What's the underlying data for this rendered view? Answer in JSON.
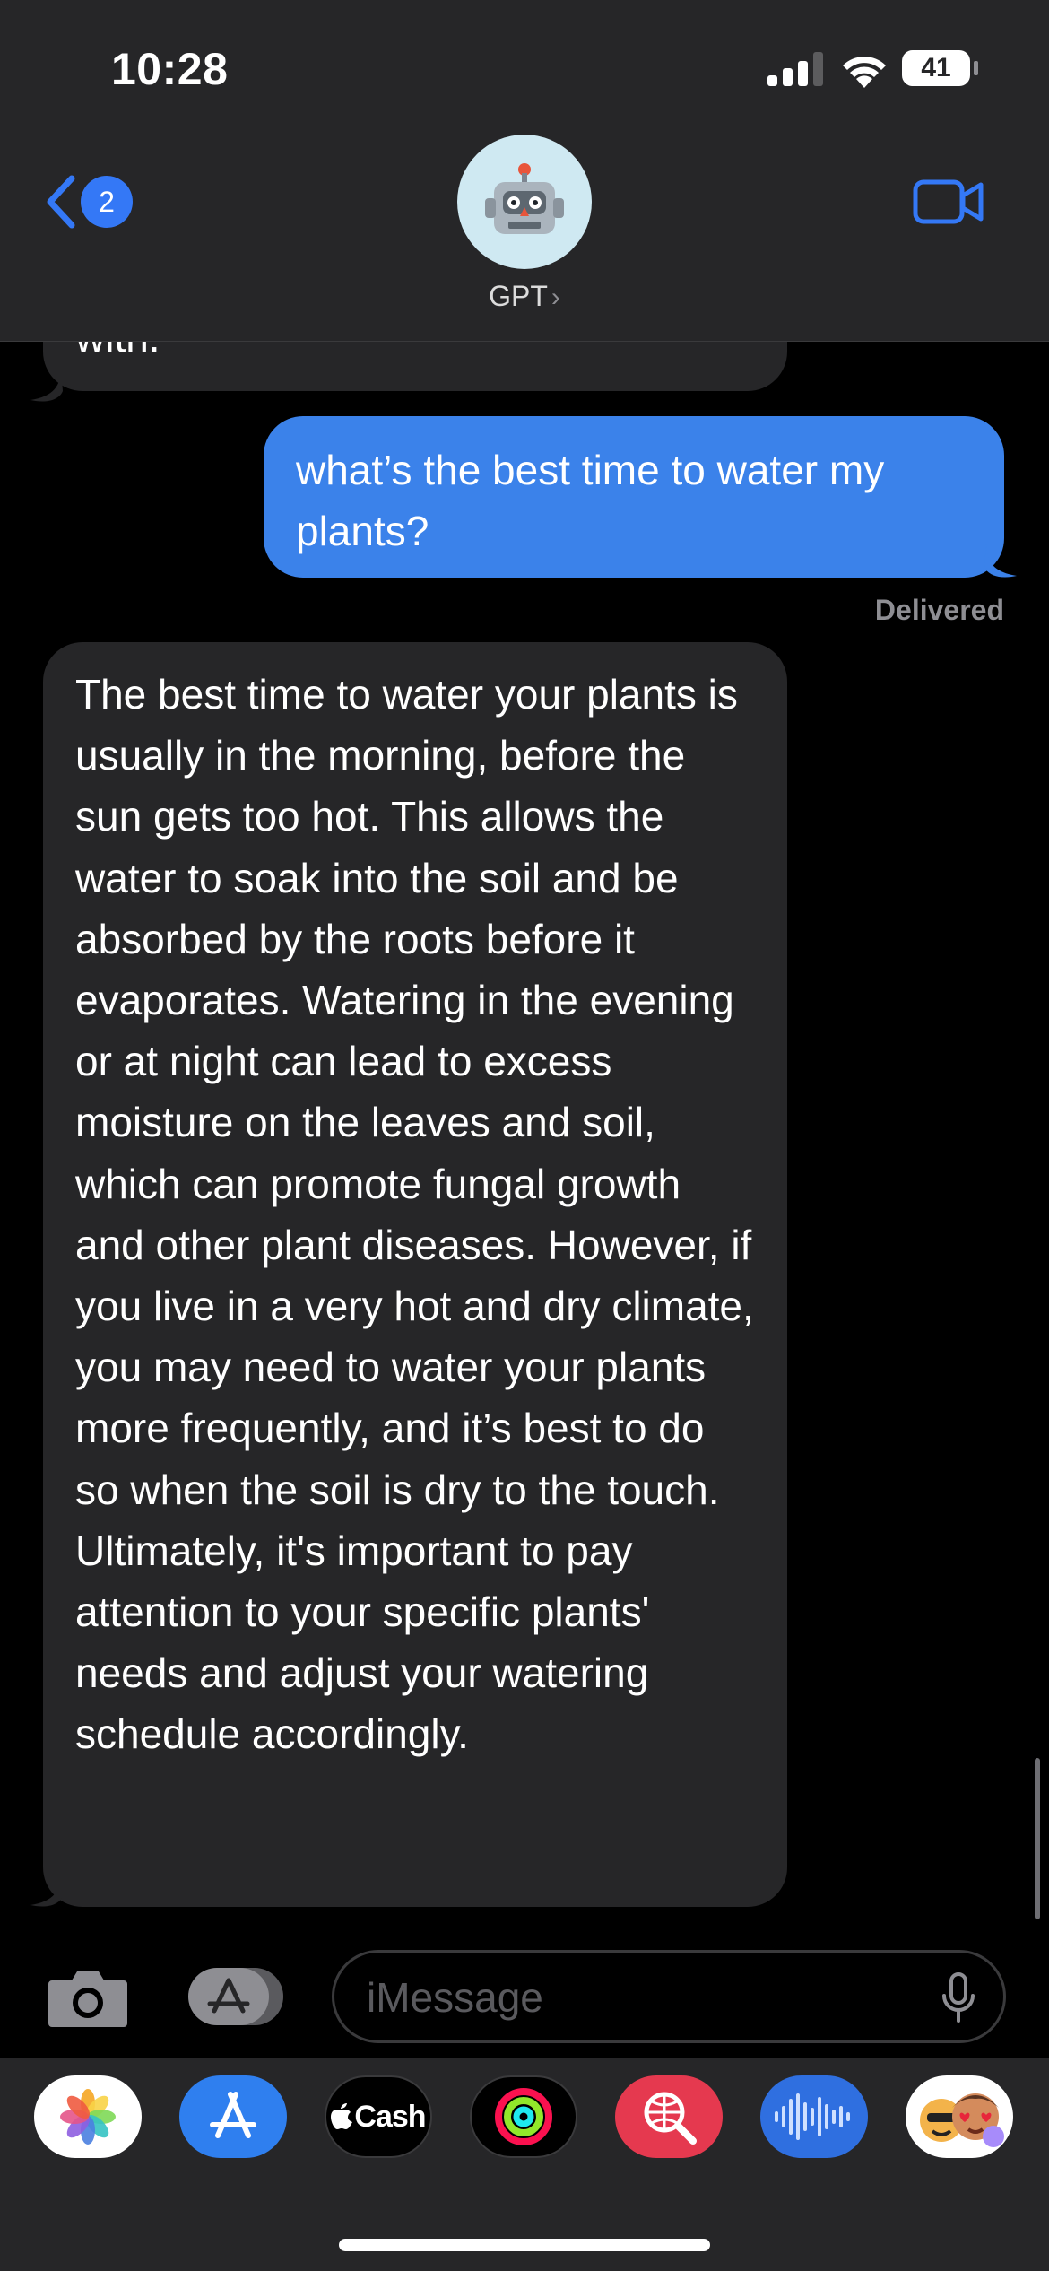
{
  "status_bar": {
    "time": "10:28",
    "battery_level": "41",
    "icons": [
      "signal-icon",
      "wifi-icon",
      "battery-icon"
    ]
  },
  "nav": {
    "back_badge_count": "2",
    "contact_name": "GPT",
    "avatar_icon": "robot-icon",
    "video_icon": "video-camera-icon"
  },
  "messages": {
    "previous_fragment": "with.",
    "sent": "what’s the best time to water my plants?",
    "sent_status": "Delivered",
    "reply": "The best time to water your plants is usually in the morning, before the sun gets too hot. This allows the water to soak into the soil and be absorbed by the roots before it evaporates. Watering in the evening or at night can lead to excess moisture on the leaves and soil, which can promote fungal growth and other plant diseases. However, if you live in a very hot and dry climate, you may need to water your plants more frequently, and it’s best to do so when the soil is dry to the touch. Ultimately, it's important to pay attention to your specific plants' needs and adjust your watering schedule accordingly."
  },
  "input": {
    "placeholder": "iMessage"
  },
  "app_drawer": {
    "cash_label": "Cash",
    "apps": [
      "photos",
      "app-store",
      "apple-cash",
      "activity",
      "web-images",
      "audio",
      "memoji"
    ]
  },
  "colors": {
    "accent": "#3478f6",
    "sent_bubble": "#3b82ea",
    "received_bubble": "#262628",
    "header_bg": "#262628"
  }
}
